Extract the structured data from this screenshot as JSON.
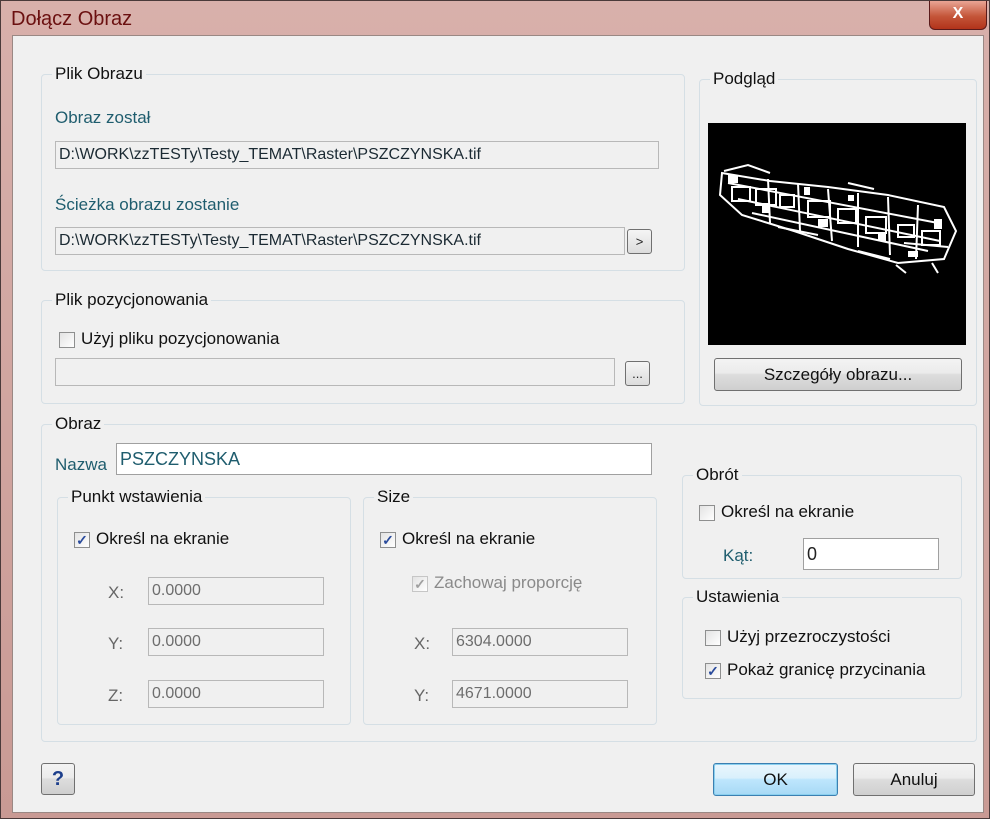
{
  "window": {
    "title": "Dołącz Obraz",
    "close_glyph": "X"
  },
  "image_file": {
    "legend": "Plik Obrazu",
    "found_label": "Obraz został",
    "found_value": "D:\\WORK\\zzTESTy\\Testy_TEMAT\\Raster\\PSZCZYNSKA.tif",
    "path_label": "Ścieżka obrazu zostanie",
    "path_value": "D:\\WORK\\zzTESTy\\Testy_TEMAT\\Raster\\PSZCZYNSKA.tif",
    "path_button": ">"
  },
  "world_file": {
    "legend": "Plik pozycjonowania",
    "checkbox_label": "Użyj pliku pozycjonowania",
    "checked": false,
    "path_value": "",
    "browse_button": "..."
  },
  "preview": {
    "legend": "Podgląd",
    "details_button": "Szczegóły obrazu..."
  },
  "image": {
    "legend": "Obraz",
    "name_label": "Nazwa",
    "name_value": "PSZCZYNSKA"
  },
  "insertion": {
    "legend": "Punkt wstawienia",
    "checkbox_label": "Określ na ekranie",
    "checked": true,
    "x_label": "X:",
    "x_value": "0.0000",
    "y_label": "Y:",
    "y_value": "0.0000",
    "z_label": "Z:",
    "z_value": "0.0000"
  },
  "size": {
    "legend": "Size",
    "checkbox_label": "Określ na ekranie",
    "checked": true,
    "keep_ratio_label": "Zachowaj proporcję",
    "keep_ratio_checked": true,
    "x_label": "X:",
    "x_value": "6304.0000",
    "y_label": "Y:",
    "y_value": "4671.0000"
  },
  "rotation": {
    "legend": "Obrót",
    "checkbox_label": "Określ na ekranie",
    "checked": false,
    "angle_label": "Kąt:",
    "angle_value": "0"
  },
  "settings": {
    "legend": "Ustawienia",
    "transparency_label": "Użyj przezroczystości",
    "transparency_checked": false,
    "clip_label": "Pokaż granicę przycinania",
    "clip_checked": true
  },
  "footer": {
    "help_button": "?",
    "ok_button": "OK",
    "cancel_button": "Anuluj"
  }
}
